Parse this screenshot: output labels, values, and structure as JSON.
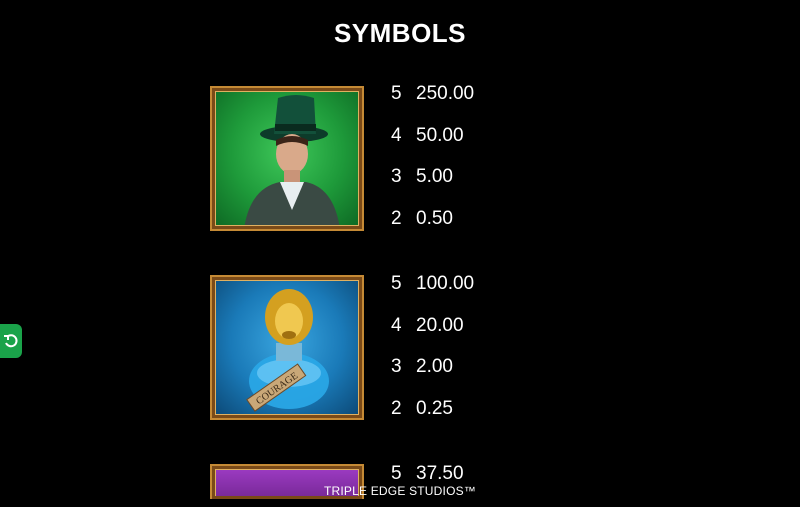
{
  "title": "SYMBOLS",
  "symbols": [
    {
      "icon": "gentleman-top-hat-icon",
      "bg_color": "#1e9a3a",
      "payouts": [
        {
          "count": "5",
          "value": "250.00"
        },
        {
          "count": "4",
          "value": "50.00"
        },
        {
          "count": "3",
          "value": "5.00"
        },
        {
          "count": "2",
          "value": "0.50"
        }
      ]
    },
    {
      "icon": "lion-courage-bottle-icon",
      "bg_color": "#1a7ab8",
      "label": "COURAGE",
      "payouts": [
        {
          "count": "5",
          "value": "100.00"
        },
        {
          "count": "4",
          "value": "20.00"
        },
        {
          "count": "3",
          "value": "2.00"
        },
        {
          "count": "2",
          "value": "0.25"
        }
      ]
    },
    {
      "icon": "purple-symbol-icon",
      "bg_color": "#7a2a9a",
      "payouts": [
        {
          "count": "5",
          "value": "37.50"
        }
      ]
    }
  ],
  "footer": "TRIPLE EDGE STUDIOS™",
  "accent": "#1aa34a"
}
